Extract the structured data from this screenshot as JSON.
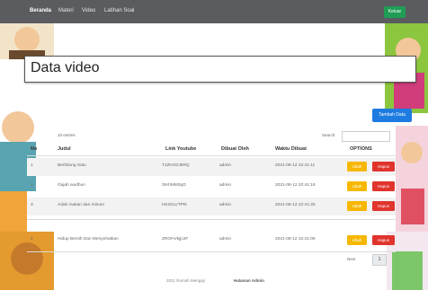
{
  "nav": {
    "brand": "Beranda",
    "items": [
      "Materi",
      "Video",
      "Latihan Soal"
    ],
    "logout": "Keluar"
  },
  "page_title": "Data video",
  "add_button": "Tambah Data",
  "table_info": "10 entries",
  "search_label": "Search:",
  "table": {
    "columns": [
      "No",
      "Judul",
      "Link Youtube",
      "Dibuat Oleh",
      "Waktu Dibuat",
      "OPTIONS"
    ],
    "rows": [
      {
        "no": "1",
        "judul": "Berhitung Satu",
        "link": "TJZKXOJ8RQ",
        "by": "admin",
        "time": "2021-08-12 22:41:11"
      },
      {
        "no": "2",
        "judul": "Gajah wudhun",
        "link": "3tAhMM3qG",
        "by": "admin",
        "time": "2021-08-12 22:41:16"
      },
      {
        "no": "3",
        "judul": "Adab makan dan minum",
        "link": "HKSGLrTPIk",
        "by": "admin",
        "time": "2021-08-12 22:41:25"
      },
      {
        "no": "4",
        "judul": "Hidup Bersih Dan Menyehatkan",
        "link": "ZROHVkjjc2F",
        "by": "admin",
        "time": "2021-08-12 22:41:09"
      }
    ],
    "edit_label": "Ubah",
    "delete_label": "Hapus"
  },
  "pagination": {
    "page": "1",
    "next": "Next"
  },
  "footer": {
    "left": "2021 Rumah Mengaji",
    "right": "Halaman Admin"
  },
  "colors": {
    "navbar": "#5a5c60",
    "add": "#1e7be0",
    "edit": "#f6b700",
    "delete": "#e0342d",
    "logout": "#1f9d55"
  }
}
